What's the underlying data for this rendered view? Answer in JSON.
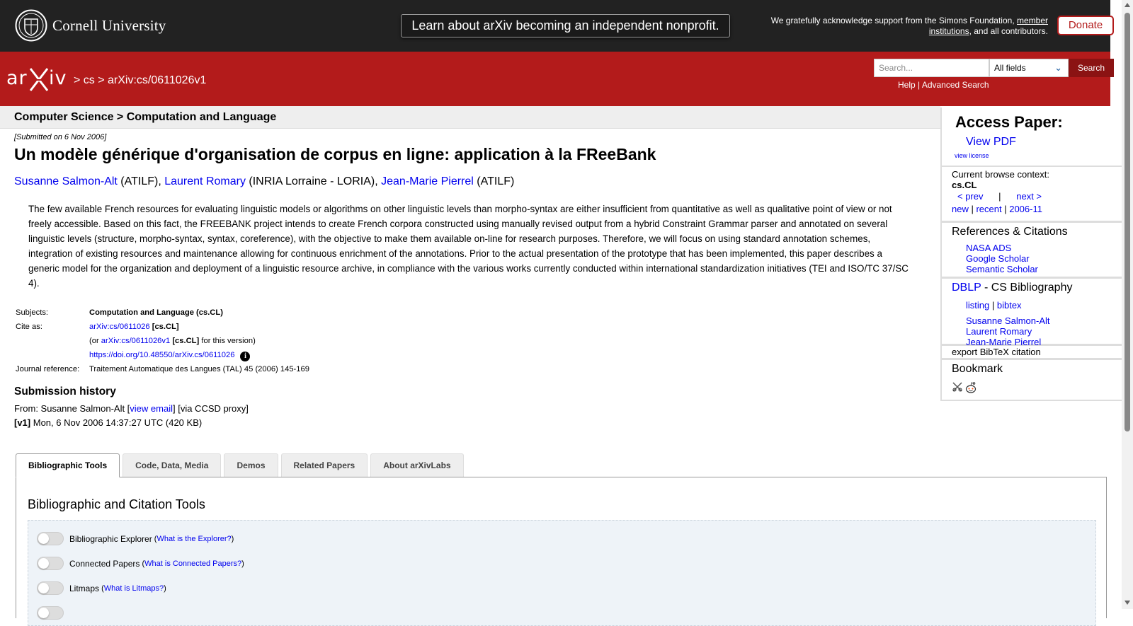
{
  "top": {
    "cornell_name": "Cornell University",
    "announcement": "Learn about arXiv becoming an independent nonprofit.",
    "ack_prefix": "We gratefully acknowledge support from the Simons Foundation, ",
    "ack_link1": "member",
    "ack_link2": "institutions",
    "ack_suffix": ", and all contributors.",
    "donate_label": "Donate"
  },
  "header": {
    "breadcrumb_sep1": " > ",
    "breadcrumb_cs": "cs",
    "breadcrumb_sep2": " > ",
    "breadcrumb_id": "arXiv:cs/0611026v1",
    "search_placeholder": "Search...",
    "search_field": "All fields",
    "search_button": "Search",
    "help_label": "Help",
    "help_sep": " | ",
    "advanced_search_label": "Advanced Search"
  },
  "paper": {
    "category_header": "Computer Science > Computation and Language",
    "submitted": "[Submitted on 6 Nov 2006]",
    "title": "Un modèle générique d'organisation de corpus en ligne: application à la FReeBank",
    "authors": [
      {
        "name": "Susanne Salmon-Alt",
        "affil": " (ATILF), "
      },
      {
        "name": "Laurent Romary",
        "affil": " (INRIA Lorraine - LORIA), "
      },
      {
        "name": "Jean-Marie Pierrel",
        "affil": " (ATILF)"
      }
    ],
    "abstract": "The few available French resources for evaluating linguistic models or algorithms on other linguistic levels than morpho-syntax are either insufficient from quantitative as well as qualitative point of view or not freely accessible. Based on this fact, the FREEBANK project intends to create French corpora constructed using manually revised output from a hybrid Constraint Grammar parser and annotated on several linguistic levels (structure, morpho-syntax, syntax, coreference), with the objective to make them available on-line for research purposes. Therefore, we will focus on using standard annotation schemes, integration of existing resources and maintenance allowing for continuous enrichment of the annotations. Prior to the actual presentation of the prototype that has been implemented, this paper describes a generic model for the organization and deployment of a linguistic resource archive, in compliance with the various works currently conducted within international standardization initiatives (TEI and ISO/TC 37/SC 4).",
    "meta": {
      "subjects_label": "Subjects:",
      "subjects_value": "Computation and Language (cs.CL)",
      "cite_label": "Cite as:",
      "cite_link": "arXiv:cs/0611026",
      "cite_tag": " [cs.CL]",
      "version_prefix": "(or ",
      "version_link": "arXiv:cs/0611026v1",
      "version_tag": " [cs.CL]",
      "version_suffix": " for this version)",
      "doi": "https://doi.org/10.48550/arXiv.cs/0611026",
      "journal_label": "Journal reference:",
      "journal_value": "Traitement Automatique des Langues (TAL) 45 (2006) 145-169"
    },
    "history": {
      "title": "Submission history",
      "from_prefix": "From: Susanne Salmon-Alt [",
      "view_email": "view email",
      "from_suffix": "] [via CCSD proxy]",
      "v1_label": "[v1]",
      "v1_value": " Mon, 6 Nov 2006 14:37:27 UTC (420 KB)"
    }
  },
  "tabs": [
    {
      "label": "Bibliographic Tools",
      "active": true
    },
    {
      "label": "Code, Data, Media"
    },
    {
      "label": "Demos"
    },
    {
      "label": "Related Papers"
    },
    {
      "label": "About arXivLabs"
    }
  ],
  "tools": {
    "panel_title": "Bibliographic and Citation Tools",
    "items": [
      {
        "label": "Bibliographic Explorer",
        "link": "What is the Explorer?"
      },
      {
        "label": "Connected Papers",
        "link": "What is Connected Papers?"
      },
      {
        "label": "Litmaps",
        "link": "What is Litmaps?"
      }
    ]
  },
  "sidebar": {
    "access_title": "Access Paper:",
    "view_pdf": "View PDF",
    "view_license": "view license",
    "context_label": "Current browse context:",
    "context_value": "cs.CL",
    "prev": "< prev",
    "context_sep": "|",
    "next": "next >",
    "new": "new",
    "recent": "recent",
    "month": "2006-11",
    "refs_title": "References & Citations",
    "refs": [
      "NASA ADS",
      "Google Scholar",
      "Semantic Scholar"
    ],
    "dblp_link": "DBLP",
    "dblp_title": " - CS Bibliography",
    "listing": "listing",
    "bibtex": "bibtex",
    "dblp_authors": [
      "Susanne Salmon-Alt",
      "Laurent Romary",
      "Jean-Marie Pierrel"
    ],
    "export": "export BibTeX citation",
    "bookmark": "Bookmark"
  }
}
